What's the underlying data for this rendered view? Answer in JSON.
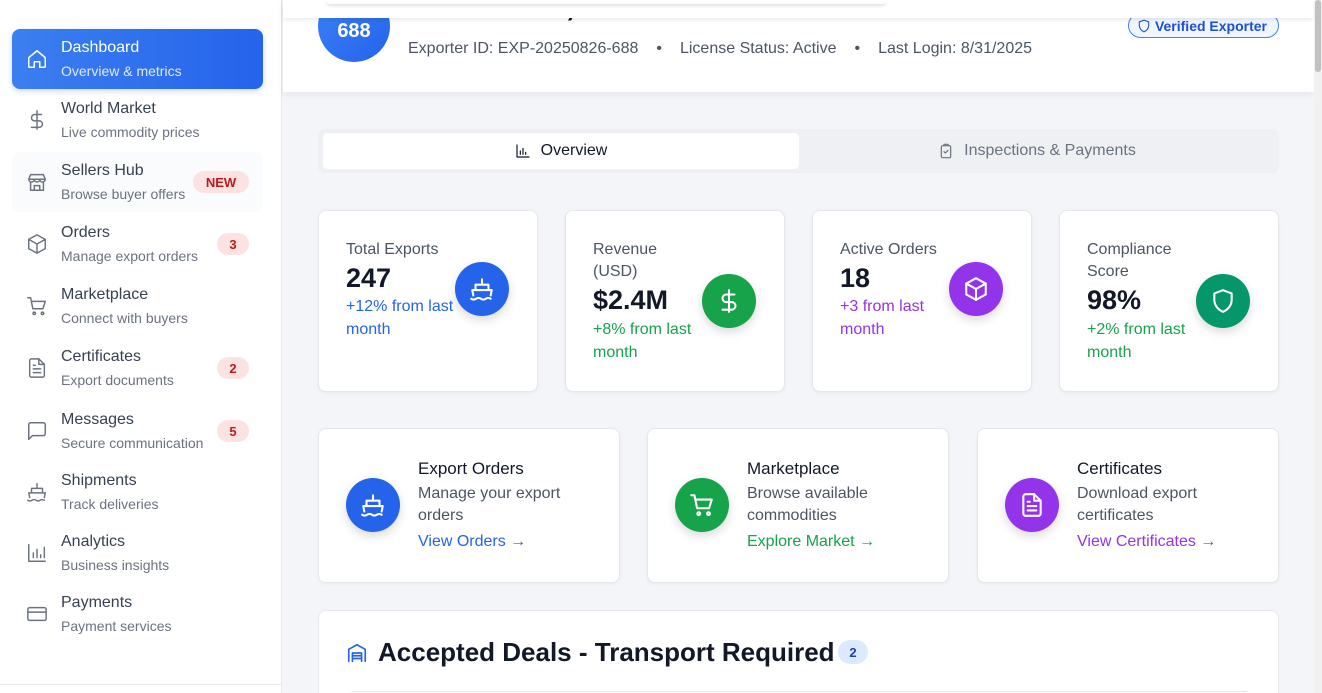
{
  "header": {
    "avatar_text": "688",
    "welcome": "Welcome, ATHRAV EXPORTS",
    "exporter_id": "Exporter ID: EXP-20250826-688",
    "license_status": "License Status: Active",
    "last_login": "Last Login: 8/31/2025",
    "separator": "•",
    "verified_label": "Verified Exporter"
  },
  "sidebar": {
    "items": [
      {
        "title": "Dashboard",
        "subtitle": "Overview & metrics",
        "icon": "home-icon",
        "active": true
      },
      {
        "title": "World Market",
        "subtitle": "Live commodity prices",
        "icon": "dollar-icon"
      },
      {
        "title": "Sellers Hub",
        "subtitle": "Browse buyer offers",
        "icon": "store-icon",
        "badge": "NEW"
      },
      {
        "title": "Orders",
        "subtitle": "Manage export orders",
        "icon": "package-icon",
        "badge": "3"
      },
      {
        "title": "Marketplace",
        "subtitle": "Connect with buyers",
        "icon": "cart-icon"
      },
      {
        "title": "Certificates",
        "subtitle": "Export documents",
        "icon": "document-icon",
        "badge": "2"
      },
      {
        "title": "Messages",
        "subtitle": "Secure communication",
        "icon": "message-icon",
        "badge": "5"
      },
      {
        "title": "Shipments",
        "subtitle": "Track deliveries",
        "icon": "ship-icon"
      },
      {
        "title": "Analytics",
        "subtitle": "Business insights",
        "icon": "bar-chart-icon"
      },
      {
        "title": "Payments",
        "subtitle": "Payment services",
        "icon": "credit-card-icon"
      }
    ]
  },
  "tabs": [
    {
      "label": "Overview",
      "icon": "bar-chart-icon",
      "active": true
    },
    {
      "label": "Inspections & Payments",
      "icon": "clipboard-check-icon",
      "active": false
    }
  ],
  "stats": [
    {
      "label": "Total Exports",
      "value": "247",
      "change": "+12% from last month",
      "color": "#2563eb",
      "icon": "ship-icon"
    },
    {
      "label": "Revenue (USD)",
      "value": "$2.4M",
      "change": "+8% from last month",
      "color": "#16a34a",
      "icon": "dollar-icon"
    },
    {
      "label": "Active Orders",
      "value": "18",
      "change": "+3 from last month",
      "color": "#9333ea",
      "icon": "package-icon"
    },
    {
      "label": "Compliance Score",
      "value": "98%",
      "change": "+2% from last month",
      "color": "#059669",
      "icon": "shield-icon"
    }
  ],
  "actions": [
    {
      "title": "Export Orders",
      "description": "Manage your export orders",
      "link": "View Orders →",
      "color": "#2563eb",
      "icon": "ship-icon"
    },
    {
      "title": "Marketplace",
      "description": "Browse available commodities",
      "link": "Explore Market →",
      "color": "#16a34a",
      "icon": "cart-icon"
    },
    {
      "title": "Certificates",
      "description": "Download export certificates",
      "link": "View Certificates →",
      "color": "#9333ea",
      "icon": "document-icon"
    }
  ],
  "deals": {
    "title": "Accepted Deals - Transport Required",
    "count": "2"
  }
}
